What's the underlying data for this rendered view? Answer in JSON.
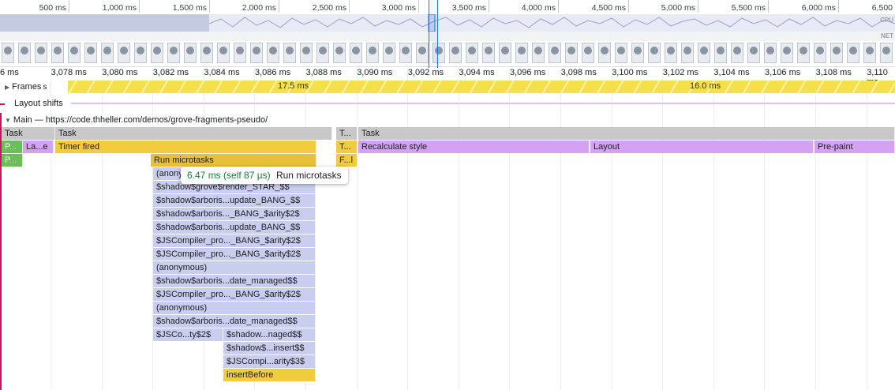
{
  "overview": {
    "ticks": [
      "500 ms",
      "1,000 ms",
      "1,500 ms",
      "2,000 ms",
      "2,500 ms",
      "3,000 ms",
      "3,500 ms",
      "4,000 ms",
      "4,500 ms",
      "5,000 ms",
      "5,500 ms",
      "6,000 ms",
      "6,500"
    ],
    "cpu_label": "CPU",
    "net_label": "NET"
  },
  "ruler": {
    "ticks": [
      "6 ms",
      "3,078 ms",
      "3,080 ms",
      "3,082 ms",
      "3,084 ms",
      "3,086 ms",
      "3,088 ms",
      "3,090 ms",
      "3,092 ms",
      "3,094 ms",
      "3,096 ms",
      "3,098 ms",
      "3,100 ms",
      "3,102 ms",
      "3,104 ms",
      "3,106 ms",
      "3,108 ms",
      "3,110 ms"
    ]
  },
  "frames": {
    "label": "Frames",
    "suffix": "s",
    "durations": [
      "17.5 ms",
      "16.0 ms"
    ]
  },
  "layout_shifts": {
    "label": "Layout shifts"
  },
  "main": {
    "label": "Main — https://code.thheller.com/demos/grove-fragments-pseudo/"
  },
  "flame": {
    "row0": [
      "Task",
      "Task",
      "T...",
      "Task"
    ],
    "row1": [
      "P...",
      "La...e",
      "Timer fired",
      "T...",
      "Recalculate style",
      "Layout",
      "Pre-paint"
    ],
    "row2": [
      "P...",
      "Run microtasks",
      "F...l"
    ],
    "stack": [
      "(anony",
      "$shadow$grove$render_STAR_$$",
      "$shadow$arboris...update_BANG_$$",
      "$shadow$arboris..._BANG_$arity$2$",
      "$shadow$arboris...update_BANG_$$",
      "$JSCompiler_pro..._BANG_$arity$2$",
      "$JSCompiler_pro..._BANG_$arity$2$",
      "(anonymous)",
      "$shadow$arboris...date_managed$$",
      "$JSCompiler_pro..._BANG_$arity$2$",
      "(anonymous)",
      "$shadow$arboris...date_managed$$",
      "$JSCo...ty$2$"
    ],
    "stack_right": [
      "$shadow...naged$$",
      "$shadow$...insert$$",
      "$JSCompi...arity$3$",
      "insertBefore"
    ]
  },
  "tooltip": {
    "time": "6.47 ms (self 87 µs)",
    "name": "Run microtasks"
  },
  "colors": {
    "task": "#c8c8c8",
    "scripting": "#f2cb3f",
    "rendering": "#d3a2f2",
    "painting": "#6bbf59",
    "js": "#c9cdee"
  }
}
